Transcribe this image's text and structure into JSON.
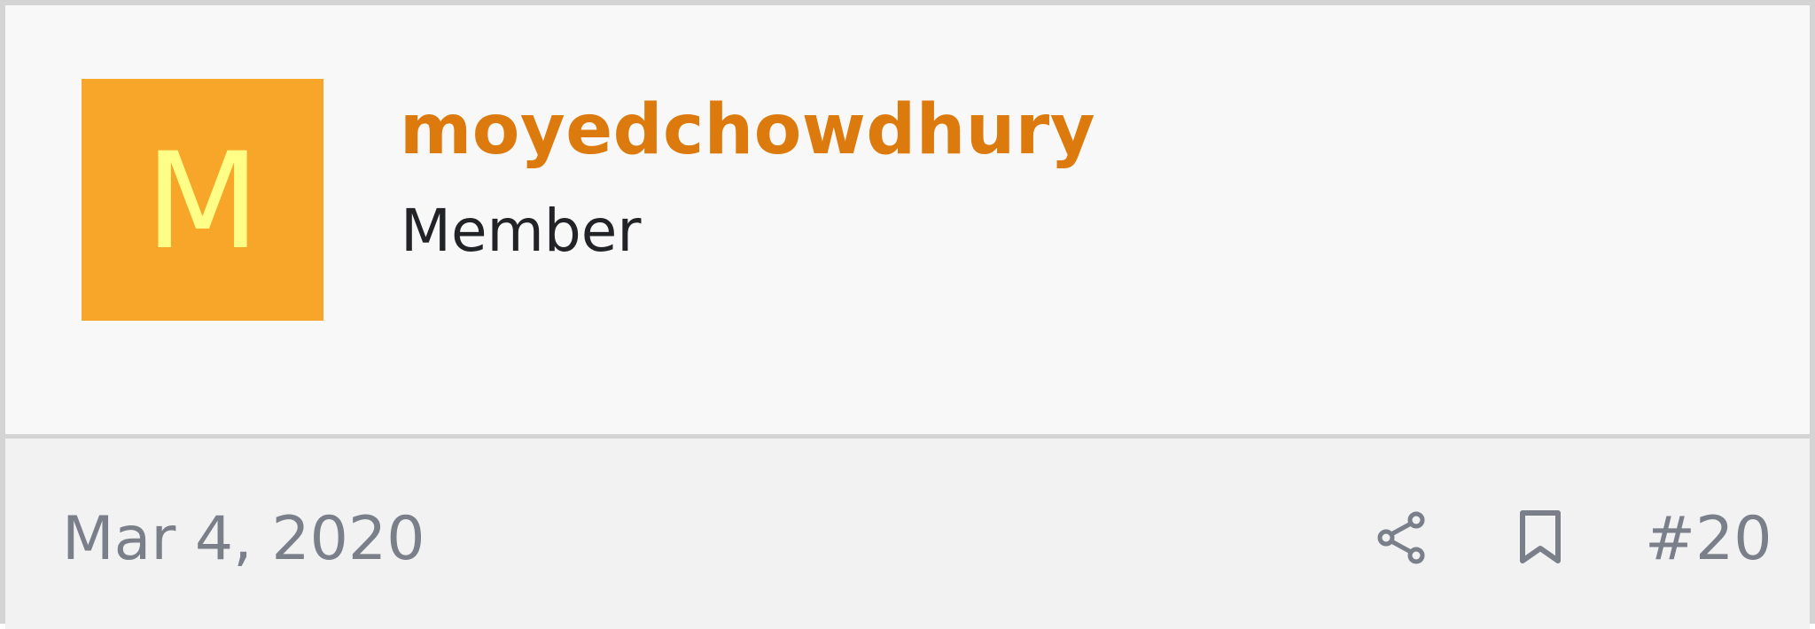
{
  "post": {
    "author": {
      "avatar_letter": "M",
      "avatar_bg": "#f8a62a",
      "avatar_fg": "#ffff88",
      "username": "moyedchowdhury",
      "username_color": "#dc7a0d",
      "title": "Member"
    },
    "footer": {
      "date": "Mar 4, 2020",
      "share_icon": "share-icon",
      "bookmark_icon": "bookmark-icon",
      "post_number": "#20"
    }
  }
}
